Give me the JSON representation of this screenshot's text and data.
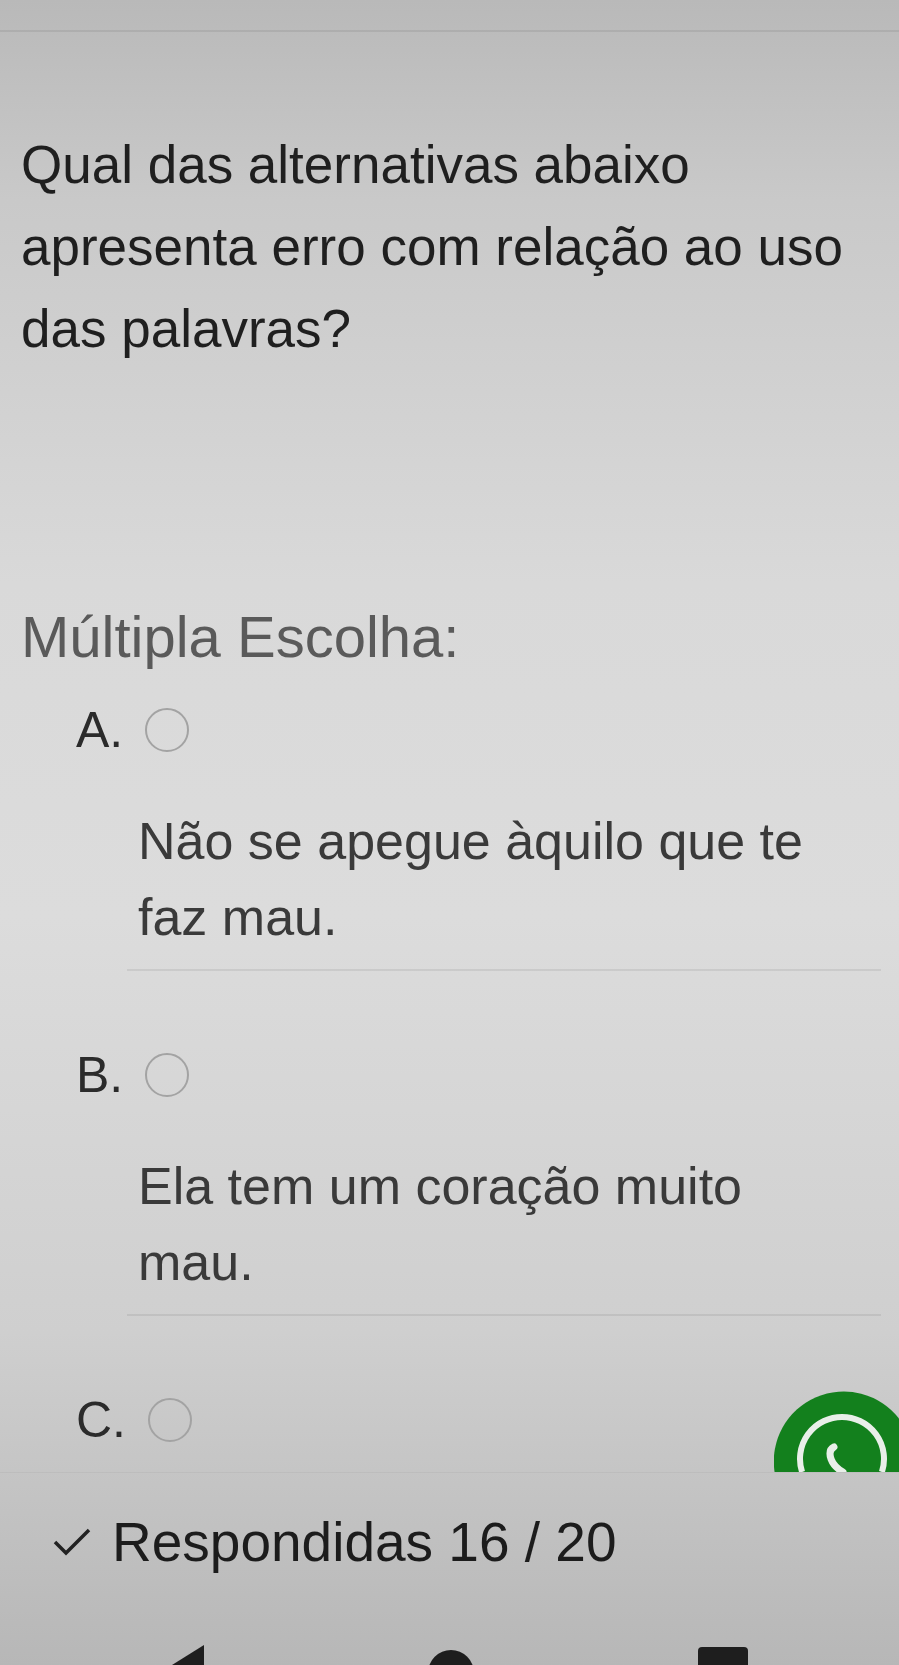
{
  "question": {
    "text": "Qual das alternativas abaixo apresenta erro com relação ao uso das palavras?"
  },
  "answer_type": {
    "label": "Múltipla Escolha:"
  },
  "options": [
    {
      "letter": "A.",
      "selected": false,
      "text": "Não se apegue àquilo que te faz mau."
    },
    {
      "letter": "B.",
      "selected": false,
      "text": "Ela tem um coração muito mau."
    },
    {
      "letter": "C.",
      "selected": false
    }
  ],
  "footer": {
    "progress": "Respondidas 16 / 20"
  }
}
